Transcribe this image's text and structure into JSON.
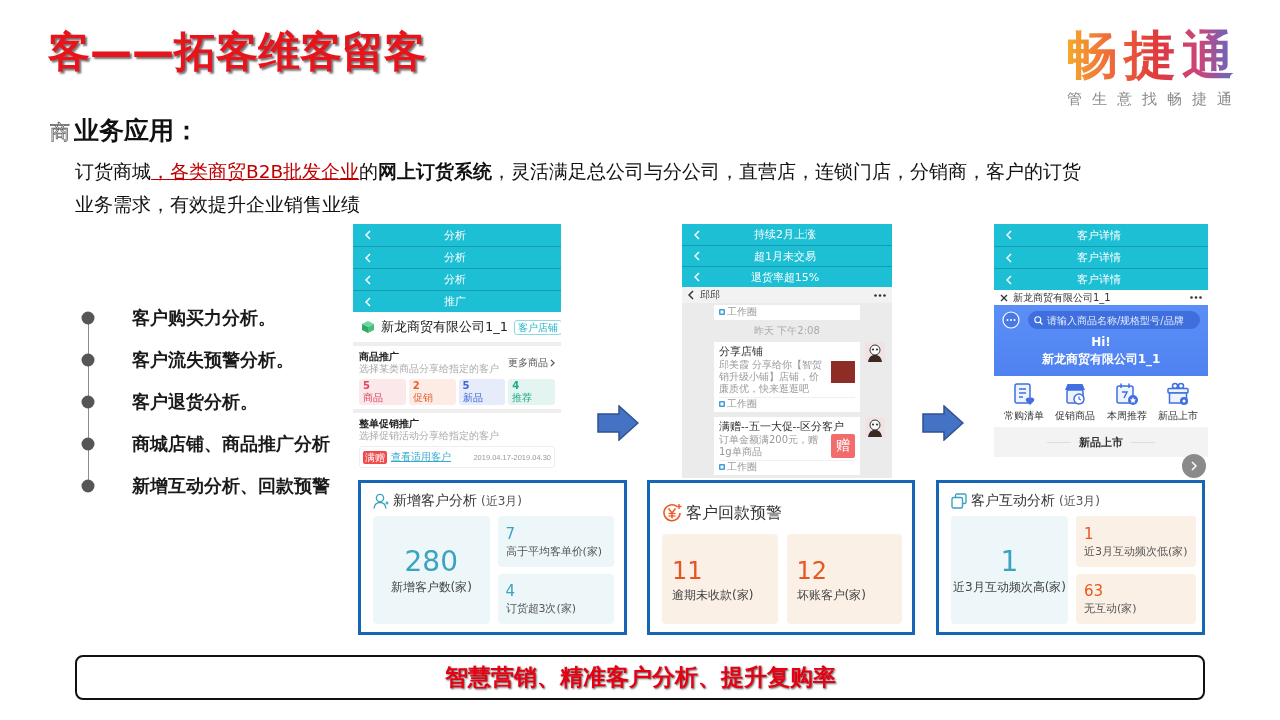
{
  "title": "客——拓客维客留客",
  "logo": {
    "name": "畅捷通",
    "slogan": "管生意找畅捷通"
  },
  "section": {
    "marker": "商",
    "heading": "业务应用："
  },
  "intro": [
    {
      "kind": "plain",
      "text": "订货商城"
    },
    {
      "kind": "highlight",
      "text": "，各类商贸B2B批发企业"
    },
    {
      "kind": "plain",
      "text": "的"
    },
    {
      "kind": "bold",
      "text": "网上订货系统"
    },
    {
      "kind": "plain",
      "text": "，灵活满足总公司与分公司，直营店，连锁门店，分销商，客户的订货业务需求，有效提升企业销售业绩"
    }
  ],
  "bullets": [
    "客户购买力分析。",
    "客户流失预警分析。",
    "客户退货分析。",
    "商城店铺、商品推广分析",
    "新增互动分析、回款预警"
  ],
  "screens": [
    {
      "kind": "promotion",
      "headers": [
        "分析",
        "分析",
        "分析",
        "推广"
      ],
      "company": "新龙商贸有限公司1_1",
      "shop_button": "客户店铺",
      "goods": {
        "title": "商品推广",
        "subtitle": "选择某类商品分享给指定的客户",
        "more": "更多商品",
        "tiles": [
          {
            "value": "5",
            "label": "商品",
            "color": "#e0435a"
          },
          {
            "value": "2",
            "label": "促销",
            "color": "#e8602c"
          },
          {
            "value": "5",
            "label": "新品",
            "color": "#3d63d8"
          },
          {
            "value": "4",
            "label": "推荐",
            "color": "#1fa98a"
          }
        ]
      },
      "promo": {
        "title": "整单促销推广",
        "subtitle": "选择促销活动分享给指定的客户",
        "tag": "满赠",
        "link": "查看适用客户",
        "dates": "2019.04.17-2019.04.30"
      }
    },
    {
      "kind": "chat",
      "headers": [
        "持续2月上涨",
        "超1月未交易",
        "退货率超15%"
      ],
      "contact": "邱邱",
      "stub_source": "工作圈",
      "time": "昨天 下午2:08",
      "messages": [
        {
          "kind": "share",
          "title": "分享店铺",
          "text": "邱美霞 分享给你【智贺销升级小铺】店铺，价廉质优，快来逛逛吧",
          "source": "工作圈"
        },
        {
          "kind": "promo",
          "title": "满赠--五一大促--区分客户",
          "text": "订单金额满200元，赠1g单商品",
          "badge": "赠",
          "source": "工作圈"
        }
      ]
    },
    {
      "kind": "store",
      "headers": [
        "客户详情",
        "客户详情",
        "客户详情"
      ],
      "store_name": "新龙商贸有限公司1_1",
      "search": {
        "placeholder": "请输入商品名称/规格型号/品牌"
      },
      "greeting": "Hi!",
      "company": "新龙商贸有限公司1_1",
      "shortcuts": [
        {
          "kind": "list",
          "label": "常购清单"
        },
        {
          "kind": "promo",
          "label": "促销商品"
        },
        {
          "kind": "calendar",
          "label": "本周推荐"
        },
        {
          "kind": "gift",
          "label": "新品上市"
        }
      ],
      "section": "新品上市"
    }
  ],
  "cards": [
    {
      "kind": "new-customers",
      "title": "新增客户分析",
      "period": "(近3月)",
      "main": {
        "kind": "cool",
        "value": "280",
        "label": "新增客户数(家)"
      },
      "side": [
        {
          "kind": "cool",
          "value": "7",
          "label": "高于平均客单价(家)"
        },
        {
          "kind": "cool",
          "value": "4",
          "label": "订货超3次(家)"
        }
      ]
    },
    {
      "kind": "payment",
      "title": "客户回款预警",
      "items": [
        {
          "kind": "warm",
          "value": "11",
          "label": "逾期未收款(家)"
        },
        {
          "kind": "warm",
          "value": "12",
          "label": "坏账客户(家)"
        }
      ]
    },
    {
      "kind": "interaction",
      "title": "客户互动分析",
      "period": "(近3月)",
      "main": {
        "kind": "cool",
        "value": "1",
        "label": "近3月互动频次高(家)"
      },
      "side": [
        {
          "kind": "warm",
          "value": "1",
          "label": "近3月互动频次低(家)"
        },
        {
          "kind": "warm",
          "value": "63",
          "label": "无互动(家)"
        }
      ]
    }
  ],
  "footer": "智慧营销、精准客户分析、提升复购率"
}
